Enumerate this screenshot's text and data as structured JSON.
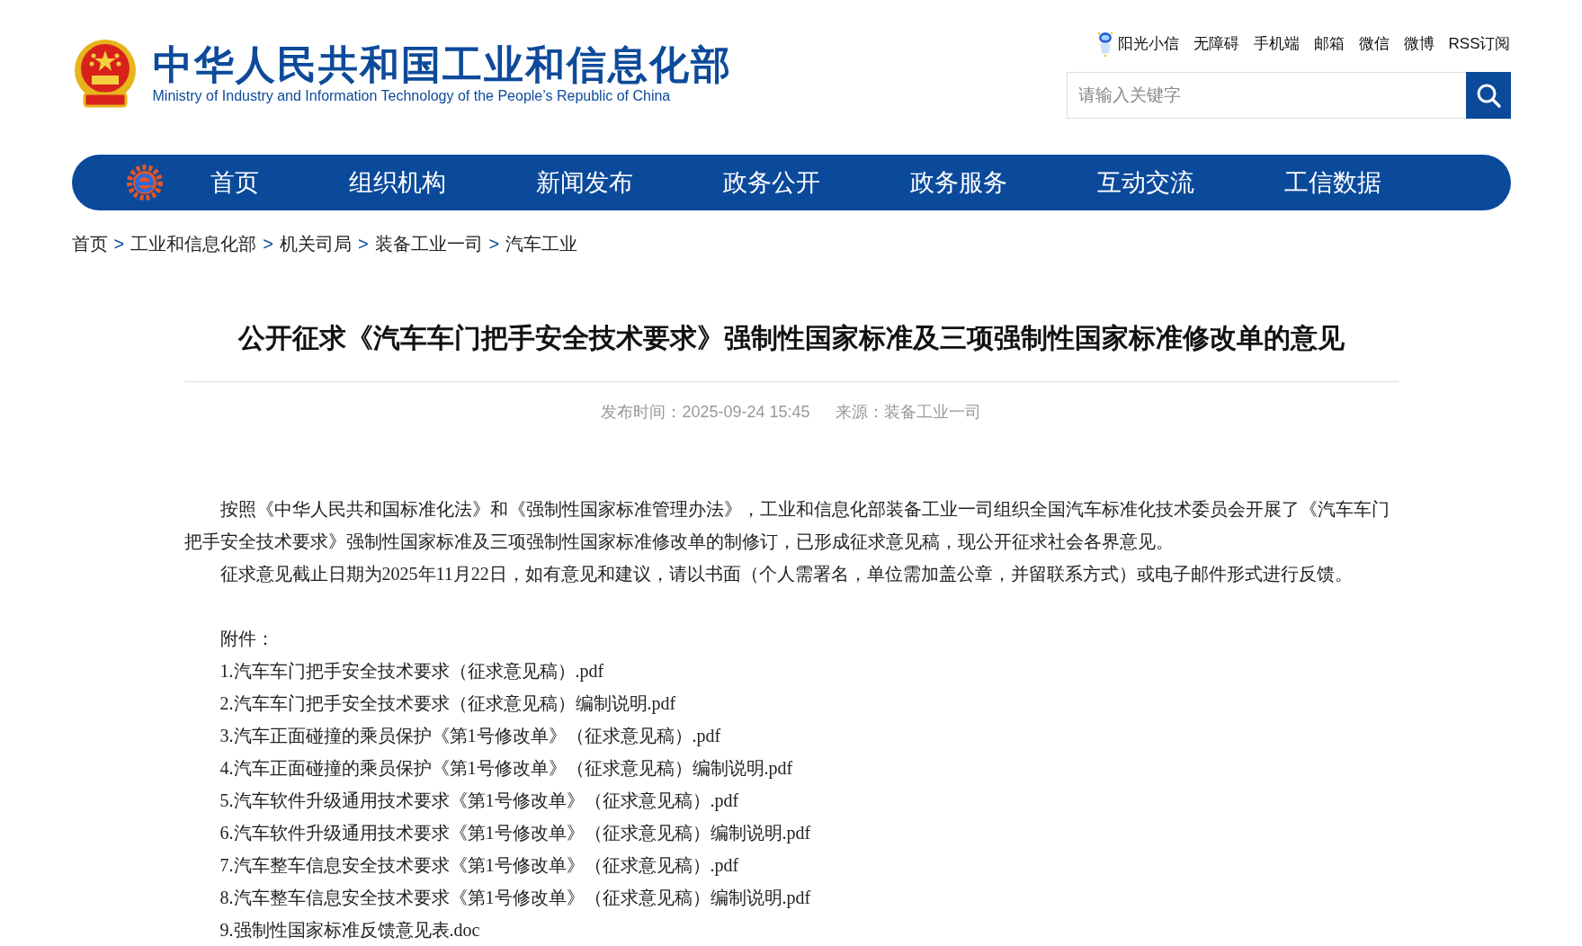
{
  "header": {
    "title": "中华人民共和国工业和信息化部",
    "subtitle": "Ministry of Industry and Information Technology of the People’s Republic of China",
    "top_links": [
      "阳光小信",
      "无障碍",
      "手机端",
      "邮箱",
      "微信",
      "微博",
      "RSS订阅"
    ],
    "search": {
      "placeholder": "请输入关键字"
    }
  },
  "nav": {
    "items": [
      "首页",
      "组织机构",
      "新闻发布",
      "政务公开",
      "政务服务",
      "互动交流",
      "工信数据"
    ]
  },
  "breadcrumb": [
    {
      "kind": "link",
      "label": "首页"
    },
    {
      "kind": "separator",
      "label": ">"
    },
    {
      "kind": "link",
      "label": "工业和信息化部"
    },
    {
      "kind": "separator",
      "label": ">"
    },
    {
      "kind": "link",
      "label": "机关司局"
    },
    {
      "kind": "separator",
      "label": ">"
    },
    {
      "kind": "link",
      "label": "装备工业一司"
    },
    {
      "kind": "separator",
      "label": ">"
    },
    {
      "kind": "link",
      "label": "汽车工业"
    }
  ],
  "article": {
    "title": "公开征求《汽车车门把手安全技术要求》强制性国家标准及三项强制性国家标准修改单的意见",
    "meta": [
      "发布时间：2025-09-24 15:45",
      "来源：装备工业一司"
    ],
    "paragraphs": [
      "按照《中华人民共和国标准化法》和《强制性国家标准管理办法》，工业和信息化部装备工业一司组织全国汽车标准化技术委员会开展了《汽车车门把手安全技术要求》强制性国家标准及三项强制性国家标准修改单的制修订，已形成征求意见稿，现公开征求社会各界意见。",
      "征求意见截止日期为2025年11月22日，如有意见和建议，请以书面（个人需署名，单位需加盖公章，并留联系方式）或电子邮件形式进行反馈。"
    ],
    "attachments_label": "附件：",
    "attachments": [
      "1.汽车车门把手安全技术要求（征求意见稿）.pdf",
      "2.汽车车门把手安全技术要求（征求意见稿）编制说明.pdf",
      "3.汽车正面碰撞的乘员保护《第1号修改单》（征求意见稿）.pdf",
      "4.汽车正面碰撞的乘员保护《第1号修改单》（征求意见稿）编制说明.pdf",
      "5.汽车软件升级通用技术要求《第1号修改单》（征求意见稿）.pdf",
      "6.汽车软件升级通用技术要求《第1号修改单》（征求意见稿）编制说明.pdf",
      "7.汽车整车信息安全技术要求《第1号修改单》（征求意见稿）.pdf",
      "8.汽车整车信息安全技术要求《第1号修改单》（征求意见稿）编制说明.pdf",
      "9.强制性国家标准反馈意见表.doc"
    ]
  }
}
